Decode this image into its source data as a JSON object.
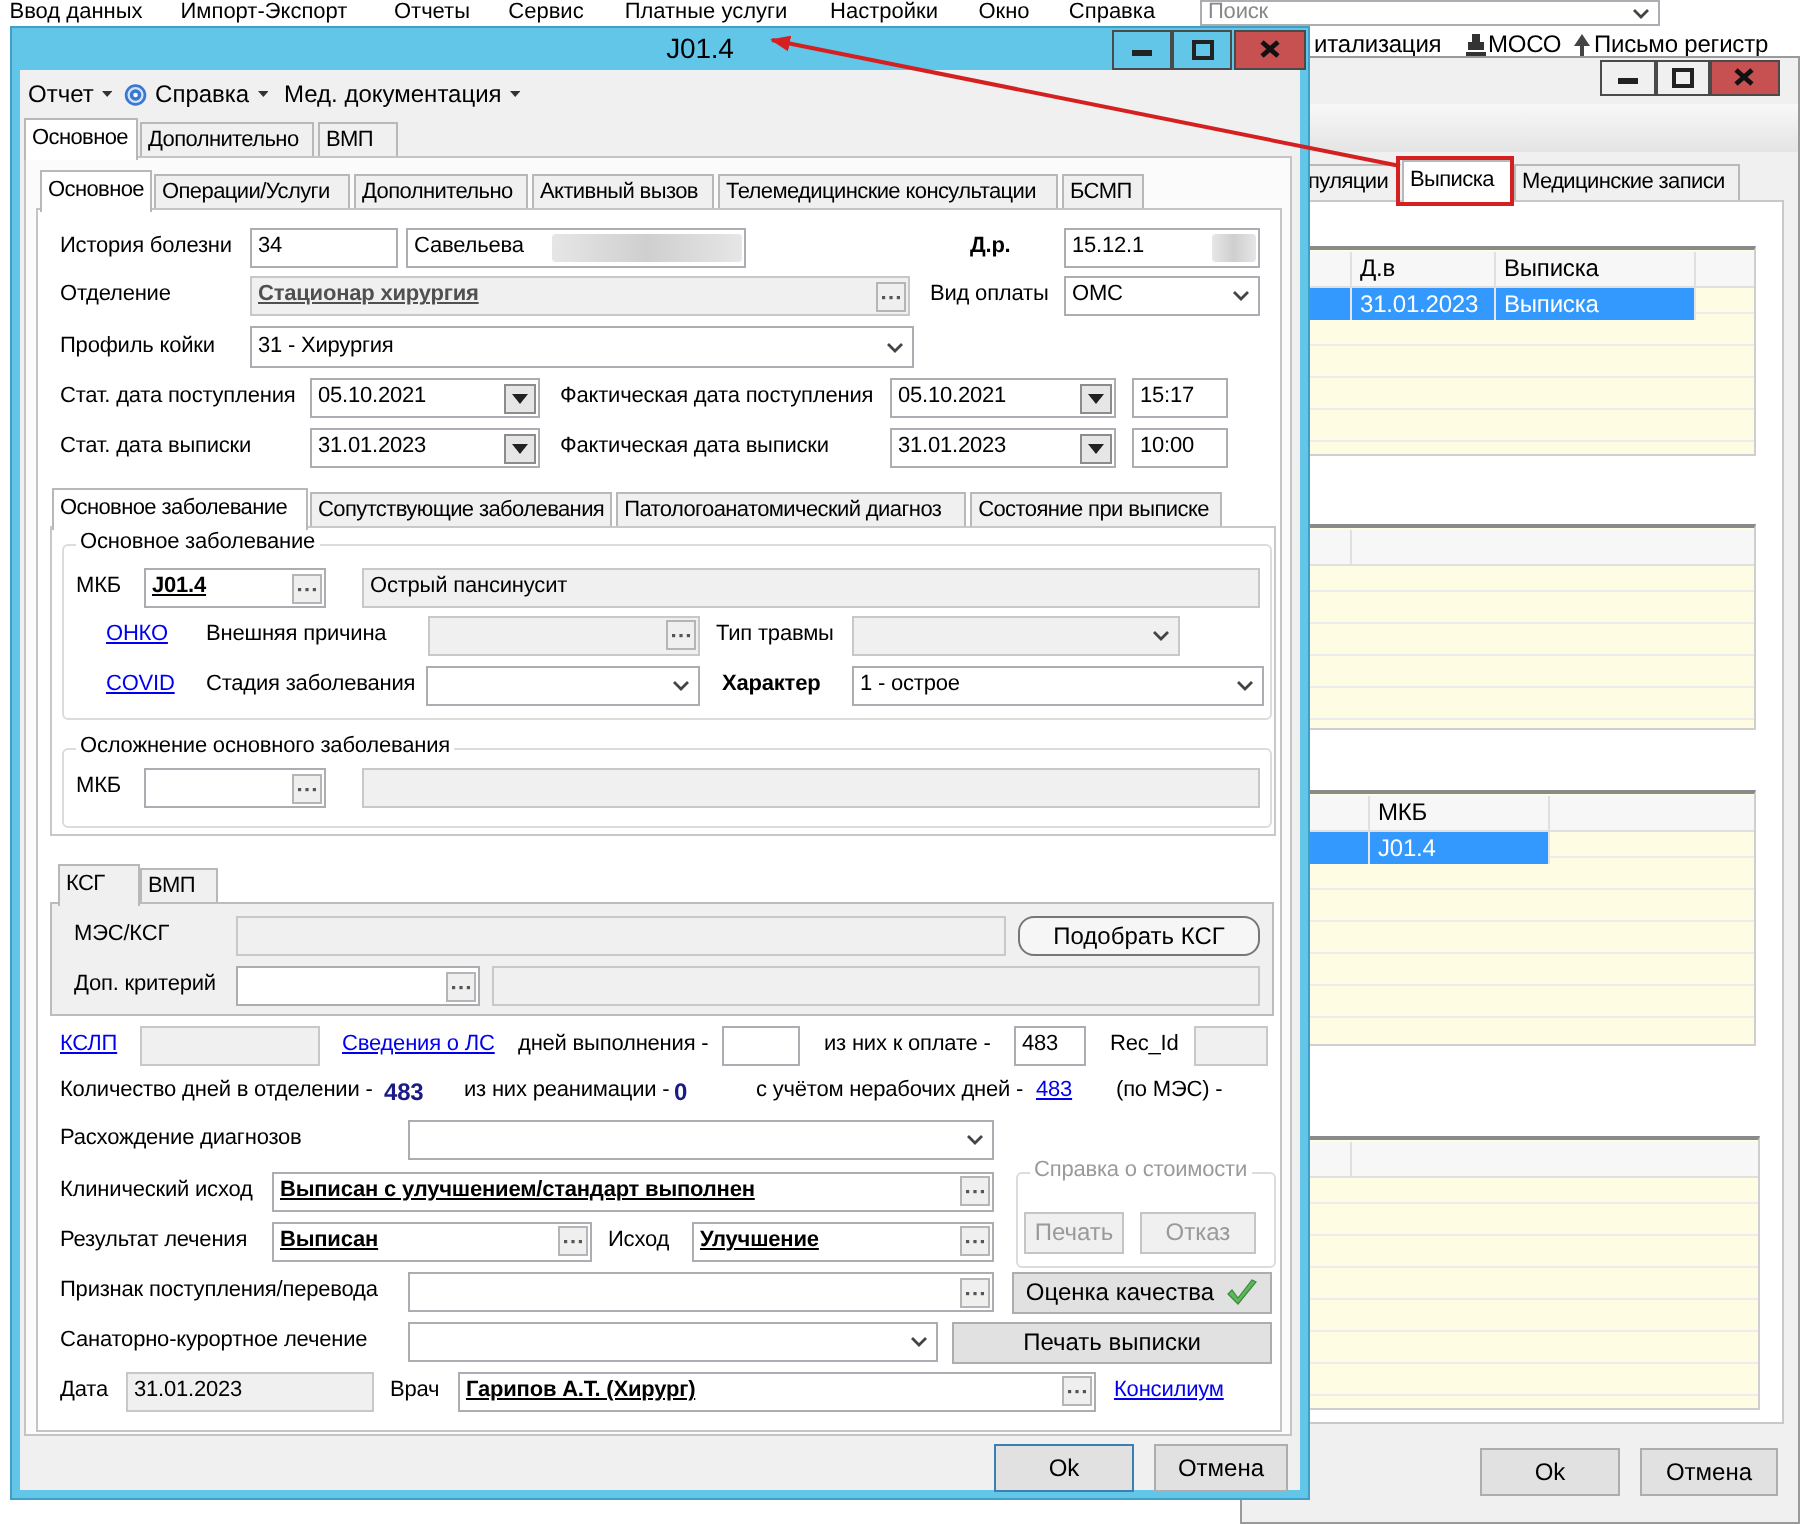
{
  "background_app": {
    "menu": [
      "Ввод данных",
      "Импорт-Экспорт",
      "Отчеты",
      "Сервис",
      "Платные услуги",
      "Настройки",
      "Окно",
      "Справка"
    ],
    "search": {
      "placeholder": "Поиск"
    },
    "toolbar": [
      "итализация",
      "МОСО",
      "Письмо регистр"
    ]
  },
  "background_window": {
    "tabs": [
      {
        "label": "пуляции",
        "selected": false
      },
      {
        "label": "Выписка",
        "selected": true
      },
      {
        "label": "Медицинские записи",
        "selected": false
      }
    ],
    "grids": [
      {
        "columns": [
          "Д.в",
          "Выписка"
        ],
        "rows": [
          {
            "cells": [
              "31.01.2023",
              "Выписка"
            ],
            "selected": true
          }
        ]
      },
      {
        "columns": [
          "МКБ"
        ],
        "rows": [
          {
            "cells": [
              "J01.4"
            ],
            "selected": true
          }
        ]
      }
    ],
    "buttons": [
      "Ok",
      "Отмена"
    ]
  },
  "dialog": {
    "title": "J01.4",
    "menu": [
      {
        "label": "Отчет",
        "kind": "plain"
      },
      {
        "label": "Справка",
        "kind": "help"
      },
      {
        "label": "Мед. документация",
        "kind": "plain"
      }
    ],
    "tabs": [
      {
        "label": "Основное",
        "selected": true
      },
      {
        "label": "Дополнительно",
        "selected": false
      },
      {
        "label": "ВМП",
        "selected": false
      }
    ],
    "inner_tabs": [
      {
        "label": "Основное",
        "selected": true
      },
      {
        "label": "Операции/Услуги",
        "selected": false
      },
      {
        "label": "Дополнительно",
        "selected": false
      },
      {
        "label": "Активный вызов",
        "selected": false
      },
      {
        "label": "Телемедицинские консультации",
        "selected": false
      },
      {
        "label": "БСМП",
        "selected": false
      }
    ],
    "patient": {
      "history_label": "История болезни",
      "history_number": "34",
      "surname": "Савельева",
      "birth_label": "Д.р.",
      "birth_date": "15.12.1"
    },
    "department": {
      "label": "Отделение",
      "value": "Стационар  хирургия"
    },
    "payment": {
      "label": "Вид оплаты",
      "value": "ОМС"
    },
    "bed_profile": {
      "label": "Профиль койки",
      "value": "31 - Хирургия"
    },
    "admission": {
      "stat_label": "Стат. дата поступления",
      "stat_date": "05.10.2021",
      "actual_label": "Фактическая дата поступления",
      "actual_date": "05.10.2021",
      "time": "15:17"
    },
    "discharge": {
      "stat_label": "Стат. дата выписки",
      "stat_date": "31.01.2023",
      "actual_label": "Фактическая дата выписки",
      "actual_date": "31.01.2023",
      "time": "10:00"
    },
    "diagnosis_tabs": [
      {
        "label": "Основное заболевание",
        "selected": true
      },
      {
        "label": "Сопутствующие заболевания",
        "selected": false
      },
      {
        "label": "Патологоанатомический диагноз",
        "selected": false
      },
      {
        "label": "Состояние при выписке",
        "selected": false
      }
    ],
    "main_disease": {
      "legend": "Основное заболевание",
      "mkb_label": "МКБ",
      "mkb_code": "J01.4",
      "mkb_name": "Острый пансинусит",
      "onko_link": "ОНКО",
      "external_label": "Внешняя причина",
      "trauma_label": "Тип травмы",
      "covid_link": "COVID",
      "stage_label": "Стадия заболевания",
      "character_label": "Характер",
      "character_value": "1 - острое"
    },
    "complication": {
      "legend": "Осложнение основного заболевания",
      "mkb_label": "МКБ"
    },
    "ksg_tabs": [
      {
        "label": "КСГ",
        "selected": true
      },
      {
        "label": "ВМП",
        "selected": false
      }
    ],
    "ksg": {
      "mes_label": "МЭС/КСГ",
      "pick_button": "Подобрать КСГ",
      "criterion_label": "Доп. критерий"
    },
    "days": {
      "kslp_link": "КСЛП",
      "ls_link": "Сведения о ЛС",
      "exec_label": "дней выполнения -",
      "paid_label": "из них к оплате -",
      "paid_value": "483",
      "rec_label": "Rec_Id"
    },
    "counts": {
      "dept_label": "Количество дней в отделении -",
      "dept_value": "483",
      "reanim_label": "из них реанимации -",
      "reanim_value": "0",
      "nonwork_label": "с учётом нерабочих дней -",
      "nonwork_link": "483",
      "mes_label": "(по МЭС) -"
    },
    "divergence_label": "Расхождение диагнозов",
    "clinical": {
      "label": "Клинический исход",
      "value": "Выписан с улучшением/стандарт выполнен"
    },
    "result": {
      "label": "Результат лечения",
      "value": "Выписан",
      "outcome_label": "Исход",
      "outcome_value": "Улучшение"
    },
    "cost_certificate": {
      "legend": "Справка о стоимости",
      "buttons": [
        {
          "label": "Печать",
          "disabled": true
        },
        {
          "label": "Отказ",
          "disabled": true
        }
      ]
    },
    "admission_sign_label": "Признак поступления/перевода",
    "quality_button": "Оценка качества",
    "sanatorium_label": "Санаторно-курортное лечение",
    "print_button": "Печать выписки",
    "date": {
      "label": "Дата",
      "value": "31.01.2023"
    },
    "doctor": {
      "label": "Врач",
      "value": "Гарипов А.Т. (Хирург)"
    },
    "council_link": "Консилиум",
    "buttons": [
      "Ok",
      "Отмена"
    ]
  }
}
